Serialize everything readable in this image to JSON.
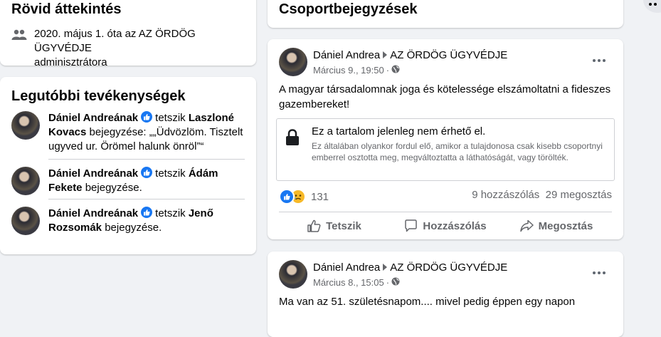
{
  "overview": {
    "title": "Rövid áttekintés",
    "line1": "2020. május 1. óta az",
    "group": "AZ ÖRDÖG ÜGYVÉDJE",
    "line2": "adminisztrátora"
  },
  "activity": {
    "title": "Legutóbbi tevékenységek",
    "items": [
      {
        "actor": "Dániel Andreának",
        "verb": "tetszik",
        "target": "Laszloné Kovacs",
        "rest": "bejegyzése: „„Üdvözlöm. Tisztelt ugyved ur. Örömel halunk önröl”“"
      },
      {
        "actor": "Dániel Andreának",
        "verb": "tetszik",
        "target": "Ádám Fekete",
        "rest": "bejegyzése."
      },
      {
        "actor": "Dániel Andreának",
        "verb": "tetszik",
        "target": "Jenő Rozsomák",
        "rest": "bejegyzése."
      }
    ]
  },
  "posts_header": {
    "title": "Csoportbejegyzések"
  },
  "posts": [
    {
      "author": "Dániel Andrea",
      "group": "AZ ÖRDÖG ÜGYVÉDJE",
      "time": "Március 9., 19:50",
      "text": "A magyar társadalomnak joga és kötelessége elszámoltatni a fideszes gazembereket!",
      "locked_title": "Ez a tartalom jelenleg nem érhető el.",
      "locked_desc": "Ez általában olyankor fordul elő, amikor a tulajdonosa csak kisebb csoportnyi emberrel osztotta meg, megváltoztatta a láthatóságát, vagy törölték.",
      "reactions": "131",
      "comments": "9 hozzászólás",
      "shares": "29 megosztás",
      "actions": {
        "like": "Tetszik",
        "comment": "Hozzászólás",
        "share": "Megosztás"
      }
    },
    {
      "author": "Dániel Andrea",
      "group": "AZ ÖRDÖG ÜGYVÉDJE",
      "time": "Március 8., 15:05",
      "text": "Ma van az 51. születésnapom.... mivel pedig éppen egy napon"
    }
  ],
  "icons": {
    "members": "people-icon",
    "globe": "globe-icon",
    "lock": "lock-icon",
    "like": "like-icon",
    "sad": "sad-icon"
  },
  "colors": {
    "brand": "#1877f2",
    "muted": "#65676b",
    "background": "#f0f2f5"
  }
}
